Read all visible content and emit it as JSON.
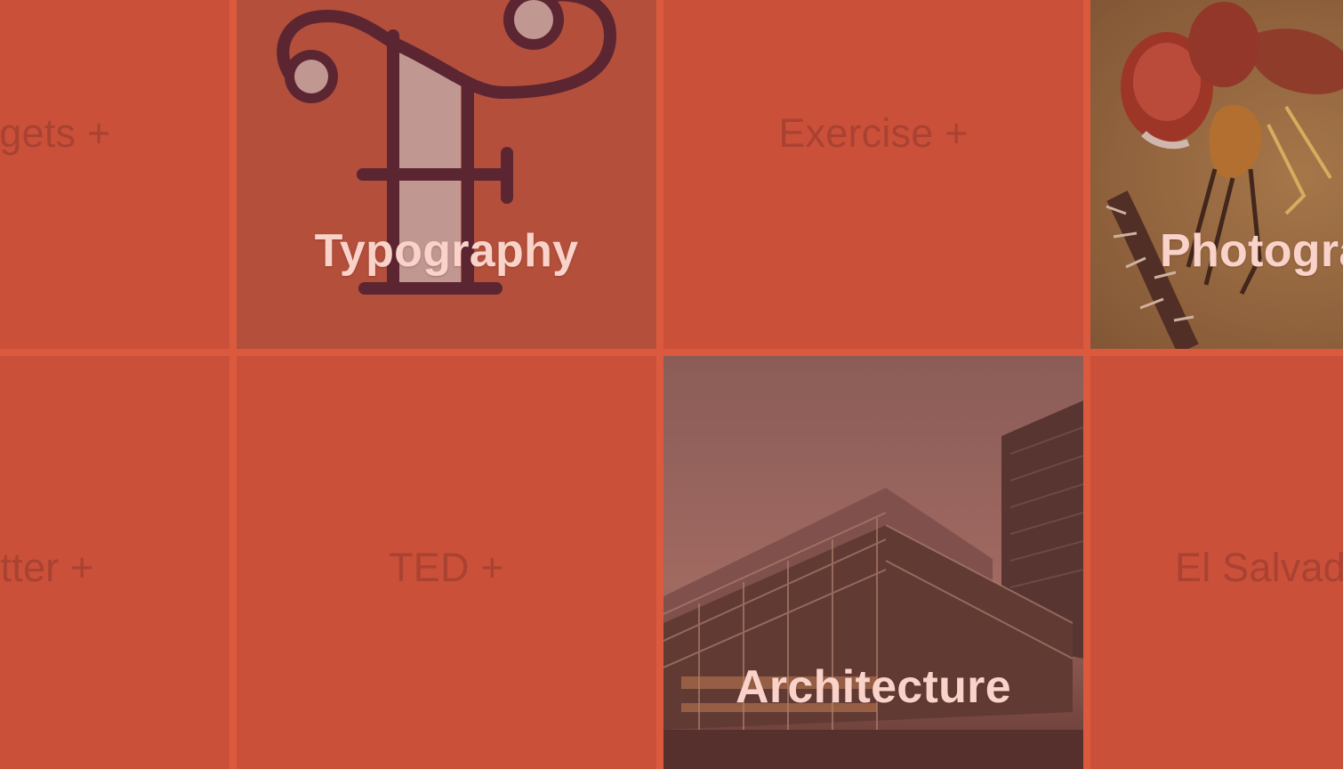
{
  "tiles": {
    "gadgets": {
      "label": "Gadgets +"
    },
    "typography": {
      "label": "Typography",
      "icon": "typography-letter-t-icon"
    },
    "exercise": {
      "label": "Exercise +"
    },
    "photography": {
      "label": "Photography",
      "image": "dragonfly-photo"
    },
    "twitter": {
      "label": "Twitter +"
    },
    "ted": {
      "label": "TED +"
    },
    "architecture": {
      "label": "Architecture",
      "image": "glass-building-photo"
    },
    "el_salvador": {
      "label": "El Salvador +"
    }
  },
  "colors": {
    "accent": "#db5a3d",
    "tile": "#ca503a",
    "featured_tile": "#b34f3b",
    "muted_text": "#aa4232",
    "label_text": "#f9d3c9",
    "icon_dark": "#5c2532"
  }
}
